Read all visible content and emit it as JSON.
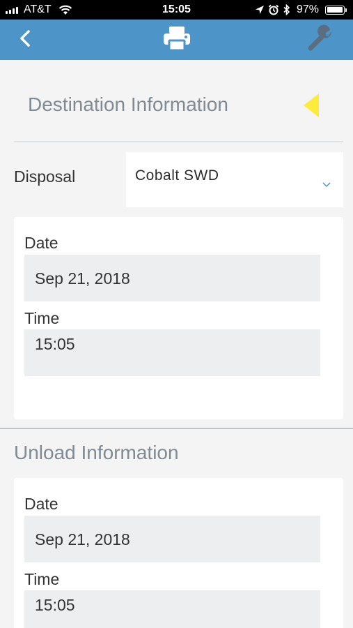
{
  "status_bar": {
    "carrier": "AT&T",
    "time": "15:05",
    "battery_percent": "97%",
    "battery_level": 0.97
  },
  "nav": {
    "back_icon": "chevron-left-icon",
    "print_icon": "printer-icon",
    "settings_icon": "wrench-icon",
    "background_color": "#4d94c8"
  },
  "destination": {
    "title": "Destination Information",
    "disposal_label": "Disposal",
    "disposal_value": "Cobalt SWD",
    "date_label": "Date",
    "date_value": "Sep 21, 2018",
    "time_label": "Time",
    "time_value": "15:05"
  },
  "unload": {
    "title": "Unload Information",
    "date_label": "Date",
    "date_value": "Sep 21, 2018",
    "time_label": "Time",
    "time_value": "15:05"
  },
  "colors": {
    "accent": "#4d94c8",
    "marker": "#ffeb3b",
    "section_title": "#7f8a93"
  }
}
